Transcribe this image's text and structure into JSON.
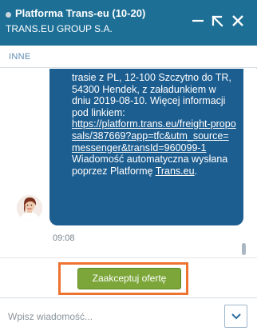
{
  "header": {
    "title": "Platforma Trans-eu (10-20)",
    "company": "TRANS.EU GROUP S.A.",
    "icons": [
      "minimize-icon",
      "expand-icon",
      "close-icon"
    ],
    "colors": {
      "background": "#1d6f96",
      "status_dot": "#c9d6de"
    }
  },
  "section": {
    "label": "INNE"
  },
  "message": {
    "lines": [
      "trasie z PL, 12-100 Szczytno do TR,",
      "54300 Hendek, z załadunkiem w",
      "dniu 2019-08-10. Więcej informacji",
      "pod linkiem:"
    ],
    "link_text": "https://platform.trans.eu/freight-proposals/387669?app=tfc&utm_source=messenger&transId=960099-1",
    "after_link": " Wiadomość automatyczna wysłana poprzez Platformę ",
    "platform_link": "Trans.eu",
    "end": ".",
    "time": "09:08",
    "colors": {
      "bubble": "#1d5e90",
      "text": "#ffffff"
    }
  },
  "actions": {
    "accept_label": "Zaakceptuj ofertę",
    "colors": {
      "button": "#7ca639",
      "highlight": "#ee7330"
    }
  },
  "input": {
    "placeholder": "Wpisz wiadomość...",
    "value": ""
  }
}
